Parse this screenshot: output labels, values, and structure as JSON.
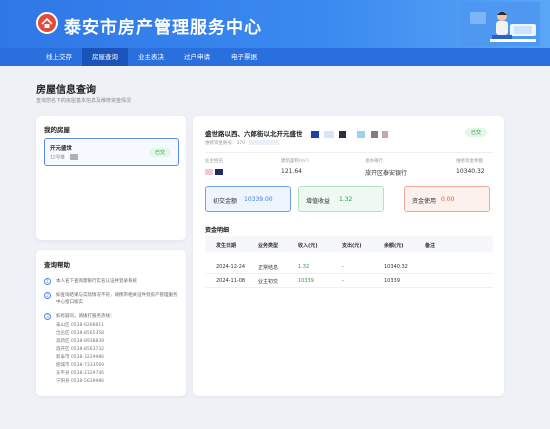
{
  "header": {
    "site_title": "泰安市房产管理服务中心"
  },
  "nav": {
    "items": [
      {
        "label": "线上交存",
        "active": false
      },
      {
        "label": "房屋查询",
        "active": true
      },
      {
        "label": "业主表决",
        "active": false
      },
      {
        "label": "过户申请",
        "active": false
      },
      {
        "label": "电子票据",
        "active": false
      }
    ]
  },
  "page": {
    "title": "房屋信息查询",
    "subtitle": "查询您名下的房屋基本信息及维修资金情况"
  },
  "my_houses": {
    "title": "我的房屋",
    "item": {
      "name": "开元盛世",
      "unit": "12号楼",
      "status": "已交"
    }
  },
  "help": {
    "title": "查询帮助",
    "items": [
      "本人名下查询需银行实名认证并登录系统",
      "如查询结果与实际情况不符，请携带相关证件到房产管理服务中心窗口核实",
      "如有疑问，请拨打服务热线："
    ],
    "phones": [
      "泰山区 0538-6268811",
      "岱岳区 0538-8565358",
      "高新区 0538-8938839",
      "旅开区 0538-8563732",
      "新泰市 0538-3229986",
      "肥城市 0538-7333569",
      "东平县 0538-2329746",
      "宁阳县 0538-5639986"
    ]
  },
  "house_detail": {
    "address": "盛世路以西、六郎街以北开元盛世",
    "status": "已交",
    "account_label": "维修资金账号：",
    "account_value": "370",
    "owner_label": "业主姓名",
    "area_label": "建筑面积(m²)",
    "area_value": "121.64",
    "bank_label": "承办银行",
    "bank_value": "旅开区泰安银行",
    "balance_label": "维修资金余额",
    "balance_value": "10340.32"
  },
  "funds": {
    "initial_label": "初交金额",
    "initial_value": "10339.00",
    "income_label": "增值收益",
    "income_value": "1.32",
    "used_label": "资金使用",
    "used_value": "0.00"
  },
  "details": {
    "title": "资金明细",
    "headers": [
      "发生日期",
      "业务类型",
      "收入(元)",
      "支出(元)",
      "余额(元)",
      "备注"
    ],
    "rows": [
      [
        "2024-12-24",
        "正常结息",
        "1.32",
        "-",
        "10340.32",
        ""
      ],
      [
        "2024-11-08",
        "业主初交",
        "10339",
        "-",
        "10339",
        ""
      ]
    ]
  },
  "colors": {
    "primary": "#2f77e6",
    "nav_active": "#1b54b8",
    "success": "#2e9c4f",
    "danger": "#e0533f",
    "info": "#3a7fe0"
  }
}
